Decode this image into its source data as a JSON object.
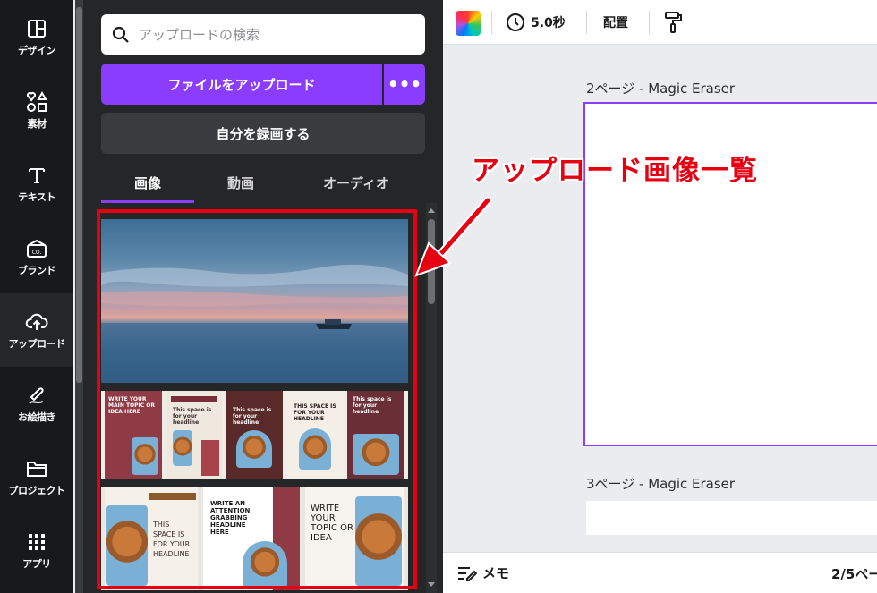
{
  "sidebar": {
    "items": [
      {
        "label": "デザイン",
        "icon": "layout-icon"
      },
      {
        "label": "素材",
        "icon": "shapes-icon"
      },
      {
        "label": "テキスト",
        "icon": "text-icon"
      },
      {
        "label": "ブランド",
        "icon": "brand-icon"
      },
      {
        "label": "アップロード",
        "icon": "cloud-upload-icon",
        "active": true
      },
      {
        "label": "お絵描き",
        "icon": "draw-icon"
      },
      {
        "label": "プロジェクト",
        "icon": "folder-icon"
      },
      {
        "label": "アプリ",
        "icon": "apps-icon"
      }
    ]
  },
  "uploads": {
    "search_placeholder": "アップロードの検索",
    "upload_button": "ファイルをアップロード",
    "more_button": "•••",
    "record_button": "自分を録画する",
    "tabs": [
      "画像",
      "動画",
      "オーディオ"
    ],
    "active_tab": 0,
    "templates_row1": [
      {
        "text": "WRITE YOUR MAIN TOPIC OR IDEA HERE"
      },
      {
        "text": "This space is for your headline"
      },
      {
        "text": "This space is for your headline"
      },
      {
        "text": "THIS SPACE IS FOR YOUR HEADLINE"
      },
      {
        "text": "This space is for your headline"
      }
    ],
    "templates_row2": [
      {
        "text": "THIS SPACE IS FOR YOUR HEADLINE"
      },
      {
        "text": "WRITE AN ATTENTION GRABBING HEADLINE HERE"
      },
      {
        "text": "WRITE YOUR TOPIC OR IDEA"
      }
    ]
  },
  "toolbar": {
    "duration": "5.0秒",
    "arrange": "配置"
  },
  "editor": {
    "page2_label": "2ページ - Magic Eraser",
    "page3_label": "3ページ - Magic Eraser"
  },
  "bottombar": {
    "memo": "メモ",
    "page_count": "2/5ペー"
  },
  "annotation": {
    "text": "アップロード画像一覧",
    "color": "#e60012"
  },
  "colors": {
    "accent": "#8b3dff",
    "rail_bg": "#18191b",
    "panel_bg": "#252627"
  }
}
